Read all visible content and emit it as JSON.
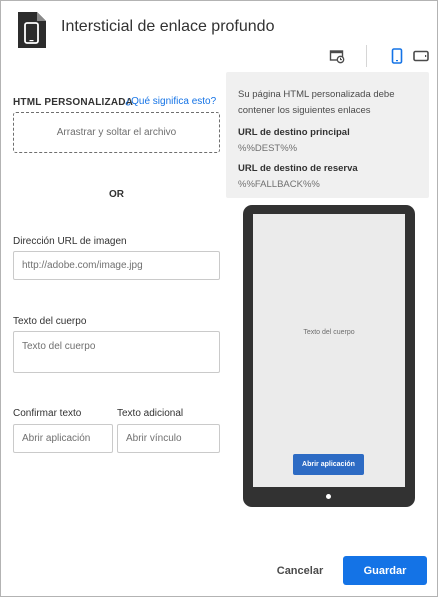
{
  "header": {
    "title": "Intersticial de enlace profundo"
  },
  "toolbar": {
    "icons": [
      "preview-refresh-icon",
      "tablet-portrait-icon",
      "tablet-landscape-icon"
    ],
    "accent_color": "#1473e6"
  },
  "form": {
    "custom_html": {
      "label": "HTML PERSONALIZADA",
      "help_link": "¿Qué significa esto?",
      "dropzone_text": "Arrastrar y soltar el archivo"
    },
    "or_text": "OR",
    "image_url": {
      "label": "Dirección URL de imagen",
      "placeholder": "http://adobe.com/image.jpg"
    },
    "body_text": {
      "label": "Texto del cuerpo",
      "placeholder": "Texto del cuerpo"
    },
    "confirm_text": {
      "label": "Confirmar texto",
      "placeholder": "Abrir aplicación"
    },
    "additional_text": {
      "label": "Texto adicional",
      "placeholder": "Abrir vínculo"
    }
  },
  "info": {
    "intro": "Su página HTML personalizada debe contener los siguientes enlaces",
    "primary_heading": "URL de destino principal",
    "primary_code": "%%DEST%%",
    "fallback_heading": "URL de destino de reserva",
    "fallback_code": "%%FALLBACK%%"
  },
  "preview": {
    "body_text": "Texto del cuerpo",
    "button_label": "Abrir aplicación",
    "button_color": "#2d6bc4"
  },
  "footer": {
    "cancel_label": "Cancelar",
    "save_label": "Guardar"
  }
}
